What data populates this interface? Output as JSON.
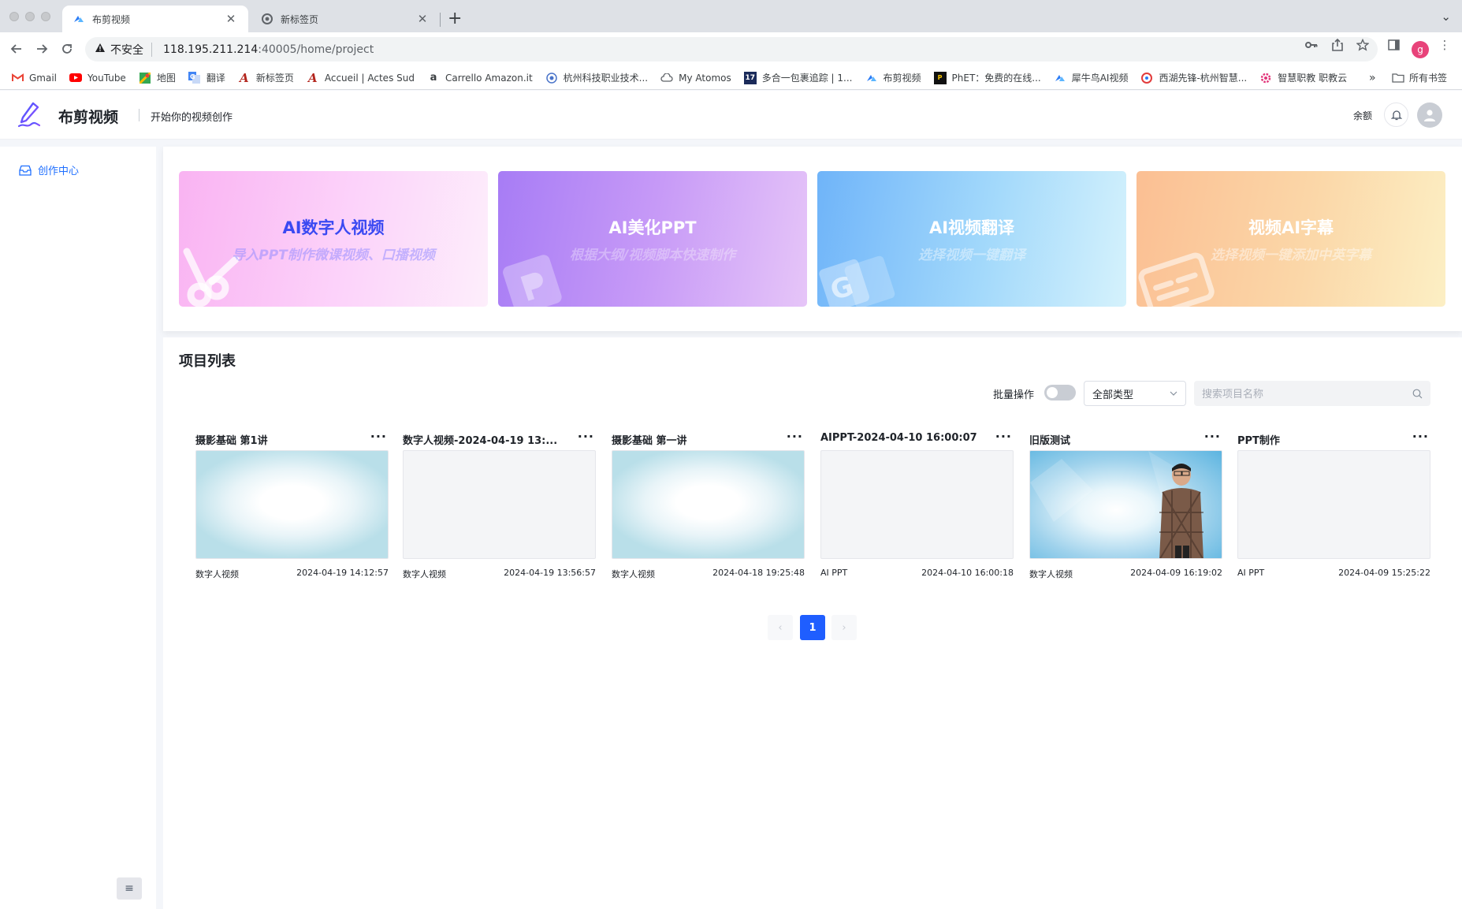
{
  "browser": {
    "tabs": [
      {
        "title": "布剪视频",
        "active": true
      },
      {
        "title": "新标签页",
        "active": false
      }
    ],
    "url_security": "不安全",
    "url_host": "118.195.211.214",
    "url_path": ":40005/home/project",
    "profile_initial": "g",
    "bookmarks": [
      "Gmail",
      "YouTube",
      "地图",
      "翻译",
      "新标签页",
      "Accueil | Actes Sud",
      "Carrello Amazon.it",
      "杭州科技职业技术...",
      "My Atomos",
      "多合一包裹追踪 | 1...",
      "布剪视频",
      "PhET：免费的在线...",
      "犀牛鸟AI视频",
      "西湖先锋-杭州智慧...",
      "智慧职教 职教云"
    ],
    "bookmarks_more": "»",
    "bookmarks_all": "所有书签"
  },
  "app": {
    "brand_name": "布剪视频",
    "slogan": "开始你的视频创作",
    "balance_label": "余额"
  },
  "sidebar": {
    "items": [
      {
        "label": "创作中心",
        "active": true
      }
    ],
    "collapse_icon": "≡"
  },
  "features": [
    {
      "title": "AI数字人视频",
      "subtitle": "导入PPT制作微课视频、口播视频",
      "icon": "scissors-icon"
    },
    {
      "title": "AI美化PPT",
      "subtitle": "根据大纲/视频脚本快速制作",
      "icon": "ppt-icon"
    },
    {
      "title": "AI视频翻译",
      "subtitle": "选择视频一键翻译",
      "icon": "translate-icon"
    },
    {
      "title": "视频AI字幕",
      "subtitle": "选择视频一键添加中英字幕",
      "icon": "subtitle-icon"
    }
  ],
  "projects": {
    "title": "项目列表",
    "batch_label": "批量操作",
    "batch_enabled": false,
    "type_filter": "全部类型",
    "search_placeholder": "搜索项目名称",
    "more_label": "···",
    "items": [
      {
        "name": "摄影基础 第1讲",
        "type": "数字人视频",
        "date": "2024-04-19 14:12:57",
        "thumb": "soft"
      },
      {
        "name": "数字人视频-2024-04-19 13:...",
        "type": "数字人视频",
        "date": "2024-04-19 13:56:57",
        "thumb": "blank"
      },
      {
        "name": "摄影基础 第一讲",
        "type": "数字人视频",
        "date": "2024-04-18 19:25:48",
        "thumb": "soft"
      },
      {
        "name": "AIPPT-2024-04-10 16:00:07",
        "type": "AI PPT",
        "date": "2024-04-10 16:00:18",
        "thumb": "blank"
      },
      {
        "name": "旧版测试",
        "type": "数字人视频",
        "date": "2024-04-09 16:19:02",
        "thumb": "scene"
      },
      {
        "name": "PPT制作",
        "type": "AI PPT",
        "date": "2024-04-09 15:25:22",
        "thumb": "blank"
      }
    ],
    "pagination": {
      "current": "1",
      "prev": "‹",
      "next": "›"
    }
  },
  "colors": {
    "accent": "#1f5eff",
    "sidebar_active": "#1f6fff"
  }
}
